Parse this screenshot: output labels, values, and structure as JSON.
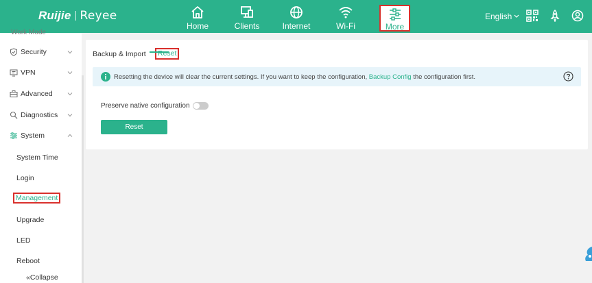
{
  "brand": {
    "name": "Ruijie",
    "sub_brand": "Reyee",
    "logo_mark": "Ruijie | Reyee"
  },
  "nav": {
    "items": [
      {
        "label": "Home",
        "icon": "home-icon"
      },
      {
        "label": "Clients",
        "icon": "monitor-icon"
      },
      {
        "label": "Internet",
        "icon": "globe-icon"
      },
      {
        "label": "Wi-Fi",
        "icon": "wifi-icon"
      },
      {
        "label": "More",
        "icon": "sliders-icon",
        "active": true
      }
    ]
  },
  "header_tools": {
    "language": "English",
    "icons": [
      "qr-code-icon",
      "rocket-icon",
      "user-icon"
    ]
  },
  "sidebar": {
    "cut_item": "Work Mode",
    "groups": [
      {
        "label": "Security",
        "icon": "shield-icon"
      },
      {
        "label": "VPN",
        "icon": "vpn-icon"
      },
      {
        "label": "Advanced",
        "icon": "briefcase-icon"
      },
      {
        "label": "Diagnostics",
        "icon": "diagnostics-icon"
      },
      {
        "label": "System",
        "icon": "system-sliders-icon",
        "expanded": true
      }
    ],
    "sub_items": [
      "System Time",
      "Login",
      "Management",
      "Upgrade",
      "LED",
      "Reboot"
    ],
    "active_sub": "Management",
    "collapse_label": "Collapse",
    "collapse_prefix": "«"
  },
  "main": {
    "tabs": [
      {
        "label": "Backup & Import"
      },
      {
        "label": "Reset",
        "active": true
      }
    ],
    "alert": {
      "text_before": "Resetting the device will clear the current settings. If you want to keep the configuration, ",
      "link": "Backup Config",
      "text_after": " the configuration first."
    },
    "preserve_label": "Preserve native configuration",
    "preserve_enabled": false,
    "reset_button": "Reset"
  },
  "colors": {
    "accent": "#2bb28c",
    "highlight": "#d9302c",
    "alert_bg": "#e7f4fa",
    "page_bg": "#f2f2f2"
  }
}
